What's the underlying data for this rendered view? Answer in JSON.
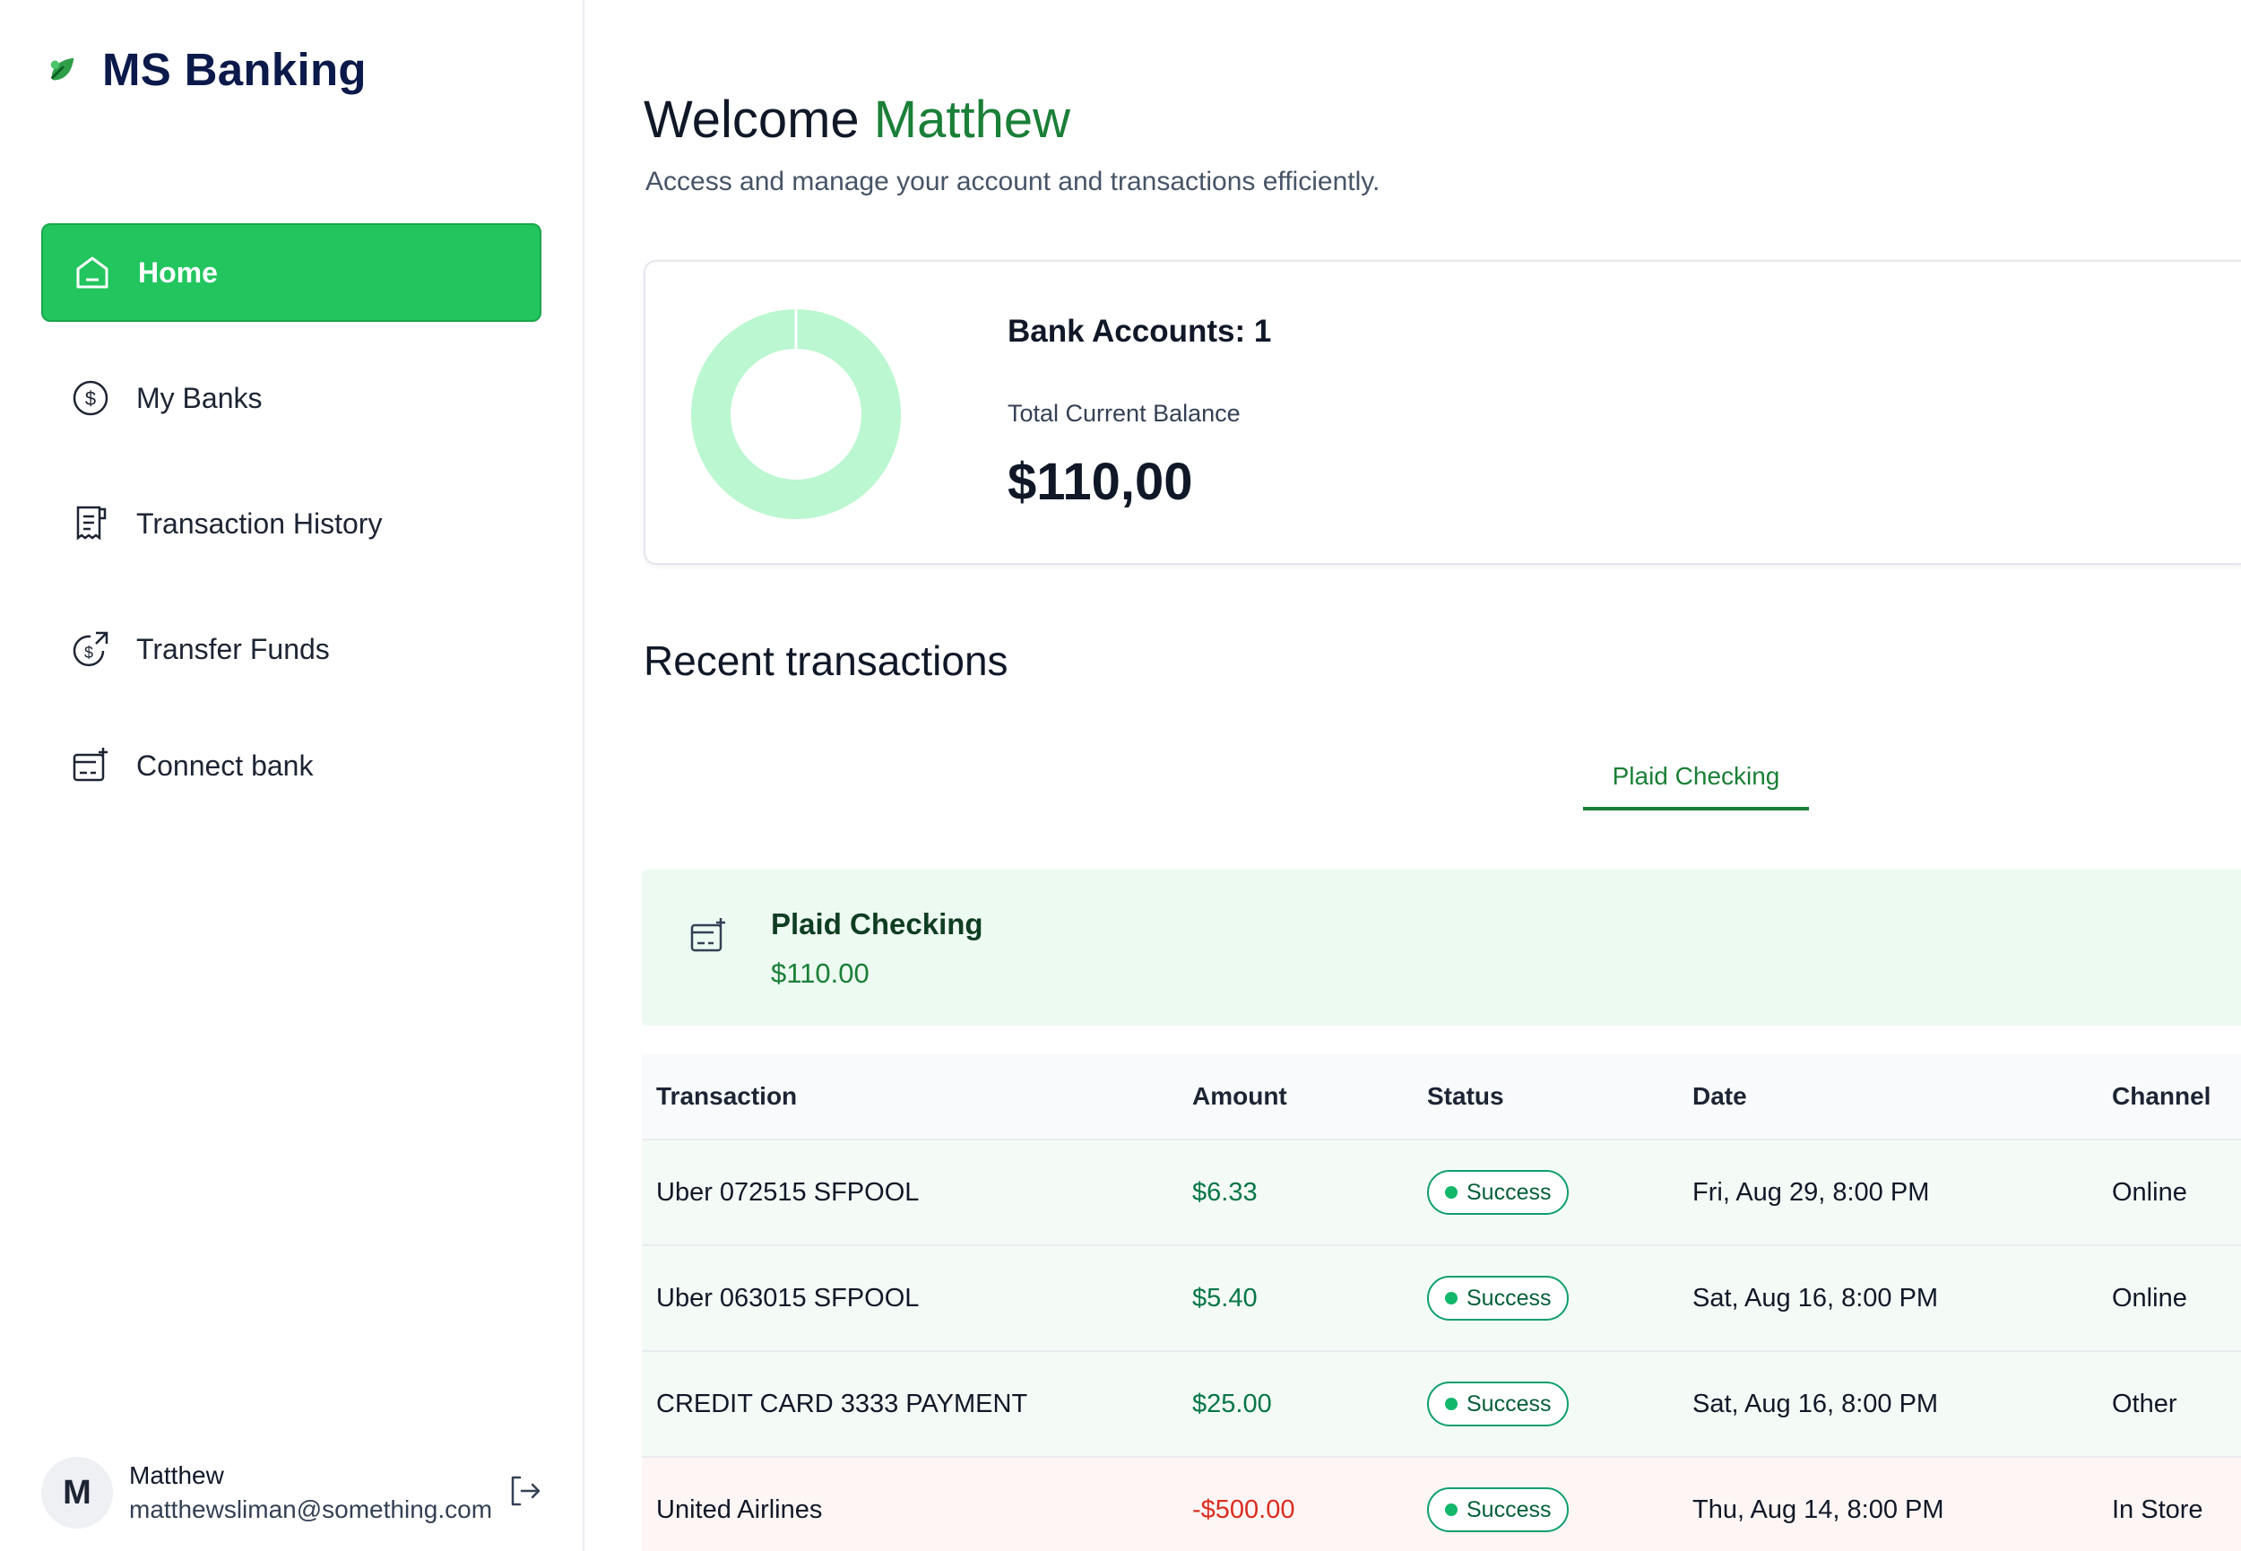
{
  "app": {
    "name": "MS Banking"
  },
  "sidebar": {
    "items": [
      {
        "label": "Home",
        "icon": "home-icon",
        "active": true
      },
      {
        "label": "My Banks",
        "icon": "dollar-circle-icon",
        "active": false
      },
      {
        "label": "Transaction History",
        "icon": "receipt-icon",
        "active": false
      },
      {
        "label": "Transfer Funds",
        "icon": "transfer-dollar-icon",
        "active": false
      },
      {
        "label": "Connect bank",
        "icon": "connect-bank-icon",
        "active": false
      }
    ],
    "user": {
      "initial": "M",
      "name": "Matthew",
      "email": "matthewsliman@something.com"
    }
  },
  "header": {
    "welcome_prefix": "Welcome",
    "user_name": "Matthew",
    "subtitle": "Access and manage your account and transactions efficiently."
  },
  "balance": {
    "accounts_label": "Bank Accounts: 1",
    "total_label": "Total Current Balance",
    "total_value": "$110,00"
  },
  "recent": {
    "title": "Recent transactions",
    "tab": "Plaid Checking",
    "bank": {
      "name": "Plaid Checking",
      "balance": "$110.00"
    },
    "columns": [
      "Transaction",
      "Amount",
      "Status",
      "Date",
      "Channel"
    ],
    "rows": [
      {
        "name": "Uber 072515 SFPOOL",
        "amount": "$6.33",
        "status": "Success",
        "date": "Fri, Aug 29, 8:00 PM",
        "channel": "Online"
      },
      {
        "name": "Uber 063015 SFPOOL",
        "amount": "$5.40",
        "status": "Success",
        "date": "Sat, Aug 16, 8:00 PM",
        "channel": "Online"
      },
      {
        "name": "CREDIT CARD 3333 PAYMENT",
        "amount": "$25.00",
        "status": "Success",
        "date": "Sat, Aug 16, 8:00 PM",
        "channel": "Other"
      },
      {
        "name": "United Airlines",
        "amount": "-$500.00",
        "status": "Success",
        "date": "Thu, Aug 14, 8:00 PM",
        "channel": "In Store"
      }
    ]
  },
  "colors": {
    "accent": "#22c55e",
    "brand_dark": "#0b1a4a",
    "positive": "#067647",
    "negative": "#d92d20"
  }
}
